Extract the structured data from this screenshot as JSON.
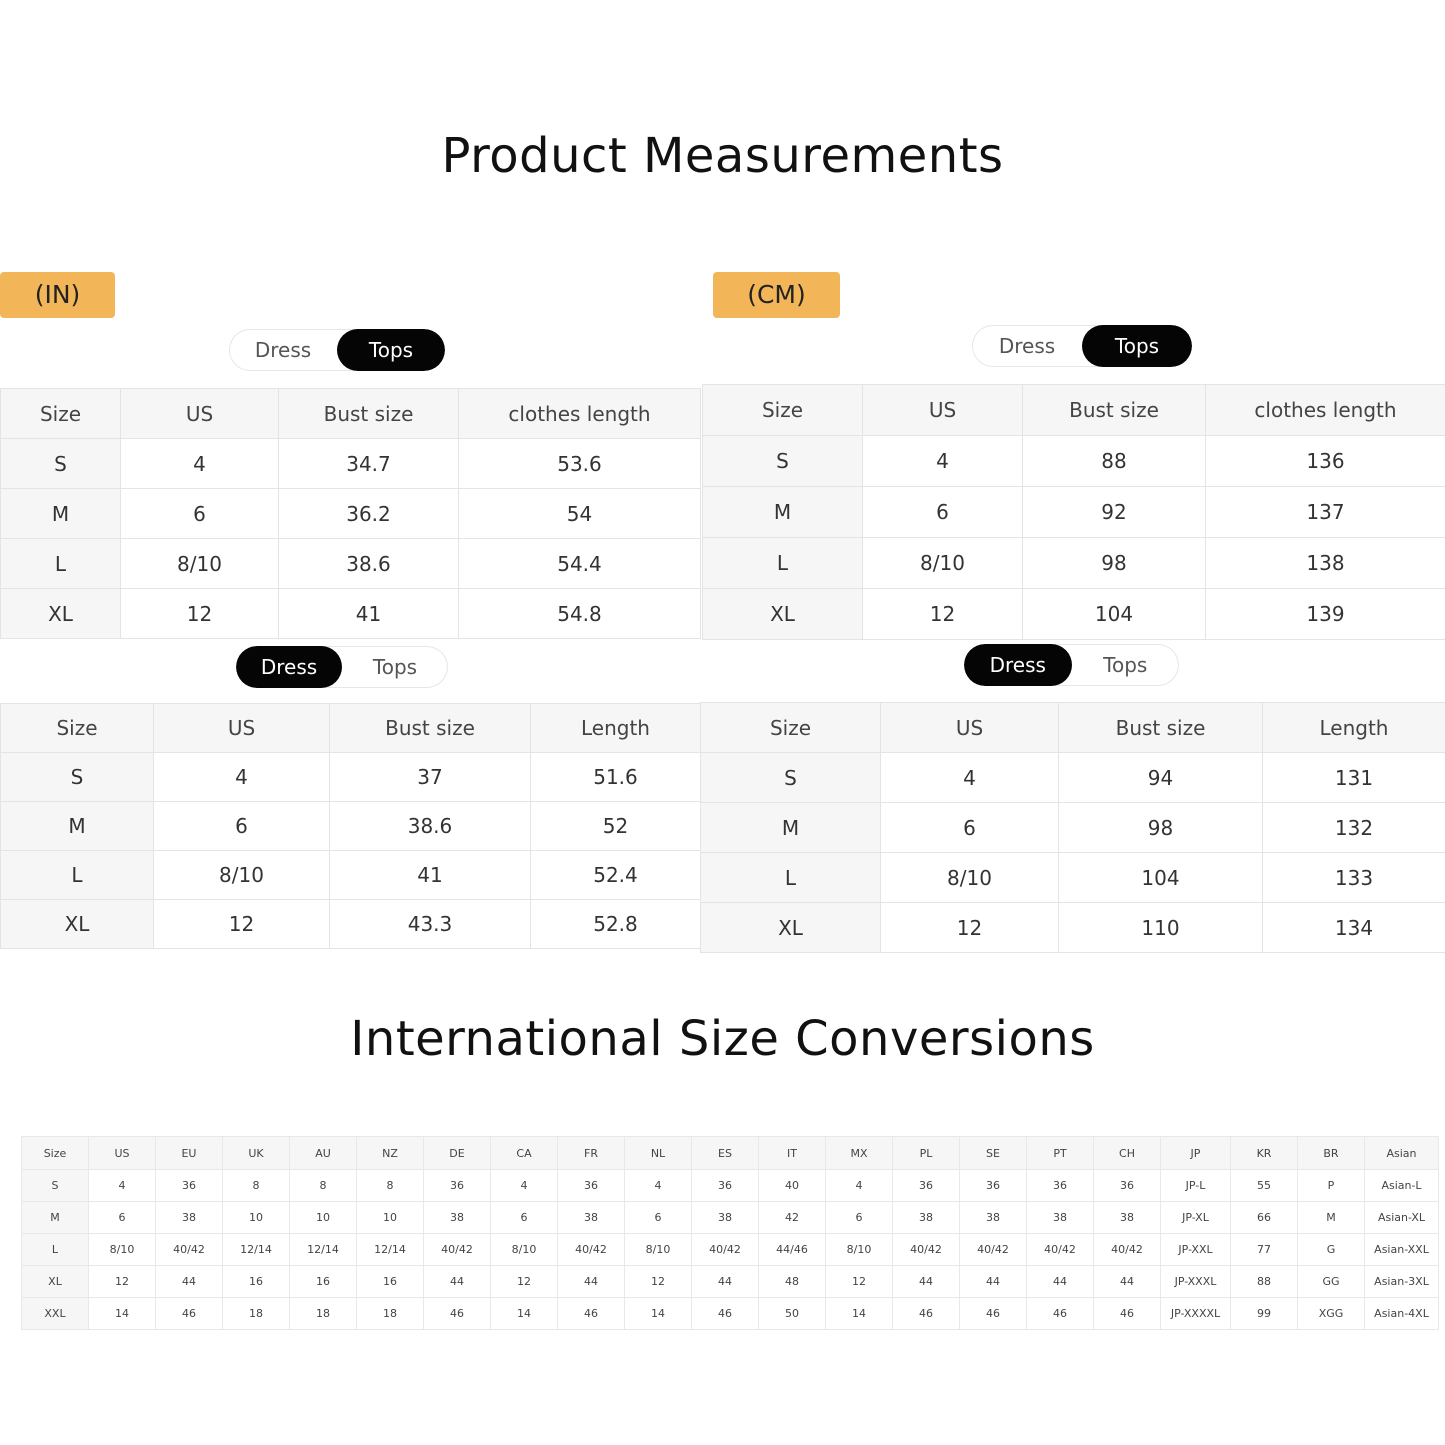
{
  "titles": {
    "measurements": "Product Measurements",
    "conversions": "International Size Conversions"
  },
  "units": {
    "in": "(IN)",
    "cm": "(CM)"
  },
  "toggle": {
    "dress": "Dress",
    "tops": "Tops"
  },
  "tables": {
    "in_tops": {
      "headers": [
        "Size",
        "US",
        "Bust size",
        "clothes length"
      ],
      "rows": [
        [
          "S",
          "4",
          "34.7",
          "53.6"
        ],
        [
          "M",
          "6",
          "36.2",
          "54"
        ],
        [
          "L",
          "8/10",
          "38.6",
          "54.4"
        ],
        [
          "XL",
          "12",
          "41",
          "54.8"
        ]
      ]
    },
    "cm_tops": {
      "headers": [
        "Size",
        "US",
        "Bust size",
        "clothes length"
      ],
      "rows": [
        [
          "S",
          "4",
          "88",
          "136"
        ],
        [
          "M",
          "6",
          "92",
          "137"
        ],
        [
          "L",
          "8/10",
          "98",
          "138"
        ],
        [
          "XL",
          "12",
          "104",
          "139"
        ]
      ]
    },
    "in_dress": {
      "headers": [
        "Size",
        "US",
        "Bust size",
        "Length"
      ],
      "rows": [
        [
          "S",
          "4",
          "37",
          "51.6"
        ],
        [
          "M",
          "6",
          "38.6",
          "52"
        ],
        [
          "L",
          "8/10",
          "41",
          "52.4"
        ],
        [
          "XL",
          "12",
          "43.3",
          "52.8"
        ]
      ]
    },
    "cm_dress": {
      "headers": [
        "Size",
        "US",
        "Bust size",
        "Length"
      ],
      "rows": [
        [
          "S",
          "4",
          "94",
          "131"
        ],
        [
          "M",
          "6",
          "98",
          "132"
        ],
        [
          "L",
          "8/10",
          "104",
          "133"
        ],
        [
          "XL",
          "12",
          "110",
          "134"
        ]
      ]
    }
  },
  "conversion": {
    "headers": [
      "Size",
      "US",
      "EU",
      "UK",
      "AU",
      "NZ",
      "DE",
      "CA",
      "FR",
      "NL",
      "ES",
      "IT",
      "MX",
      "PL",
      "SE",
      "PT",
      "CH",
      "JP",
      "KR",
      "BR",
      "Asian"
    ],
    "rows": [
      [
        "S",
        "4",
        "36",
        "8",
        "8",
        "8",
        "36",
        "4",
        "36",
        "4",
        "36",
        "40",
        "4",
        "36",
        "36",
        "36",
        "36",
        "JP-L",
        "55",
        "P",
        "Asian-L"
      ],
      [
        "M",
        "6",
        "38",
        "10",
        "10",
        "10",
        "38",
        "6",
        "38",
        "6",
        "38",
        "42",
        "6",
        "38",
        "38",
        "38",
        "38",
        "JP-XL",
        "66",
        "M",
        "Asian-XL"
      ],
      [
        "L",
        "8/10",
        "40/42",
        "12/14",
        "12/14",
        "12/14",
        "40/42",
        "8/10",
        "40/42",
        "8/10",
        "40/42",
        "44/46",
        "8/10",
        "40/42",
        "40/42",
        "40/42",
        "40/42",
        "JP-XXL",
        "77",
        "G",
        "Asian-XXL"
      ],
      [
        "XL",
        "12",
        "44",
        "16",
        "16",
        "16",
        "44",
        "12",
        "44",
        "12",
        "44",
        "48",
        "12",
        "44",
        "44",
        "44",
        "44",
        "JP-XXXL",
        "88",
        "GG",
        "Asian-3XL"
      ],
      [
        "XXL",
        "14",
        "46",
        "18",
        "18",
        "18",
        "46",
        "14",
        "46",
        "14",
        "46",
        "50",
        "14",
        "46",
        "46",
        "46",
        "46",
        "JP-XXXXL",
        "99",
        "XGG",
        "Asian-4XL"
      ]
    ]
  }
}
